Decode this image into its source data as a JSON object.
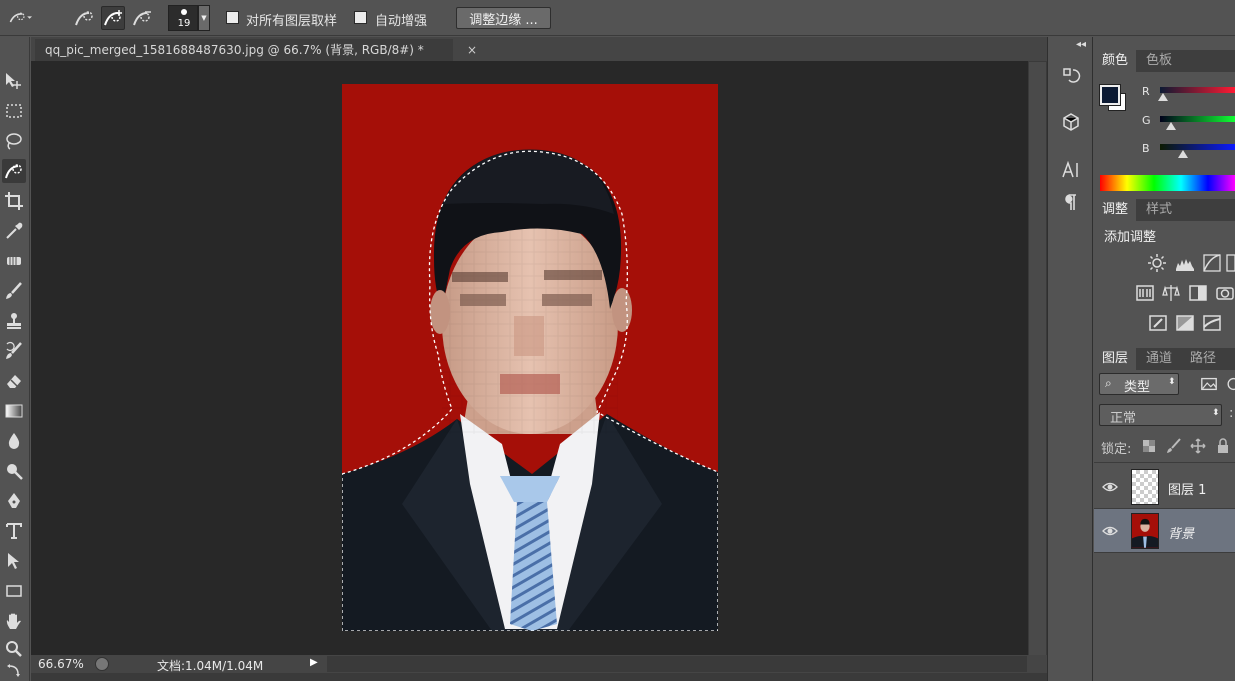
{
  "options_bar": {
    "brush_size": "19",
    "sample_all_layers_label": "对所有图层取样",
    "sample_all_layers_checked": false,
    "auto_enhance_label": "自动增强",
    "auto_enhance_checked": false,
    "refine_edge_label": "调整边缘 ..."
  },
  "document": {
    "tab_title": "qq_pic_merged_1581688487630.jpg @ 66.7% (背景, RGB/8#) *",
    "close_glyph": "×"
  },
  "status_bar": {
    "zoom": "66.67%",
    "doc_size": "文档:1.04M/1.04M"
  },
  "color_panel": {
    "tabs": [
      "颜色",
      "色板"
    ],
    "active_tab": 0,
    "foreground_color": "#0c1a33",
    "background_color": "#ffffff",
    "channels": [
      {
        "label": "R",
        "value": 12
      },
      {
        "label": "G",
        "value": 26
      },
      {
        "label": "B",
        "value": 51
      }
    ]
  },
  "adjustments_panel": {
    "tabs": [
      "调整",
      "样式"
    ],
    "active_tab": 0,
    "heading": "添加调整"
  },
  "layers_panel": {
    "tabs": [
      "图层",
      "通道",
      "路径"
    ],
    "active_tab": 0,
    "filter_kind": "类型",
    "blend_mode": "正常",
    "lock_label": "锁定:",
    "layers": [
      {
        "name": "图层 1",
        "visible": true,
        "selected": false,
        "kind": "transparent"
      },
      {
        "name": "背景",
        "visible": true,
        "selected": true,
        "kind": "photo"
      }
    ]
  },
  "colors": {
    "photo_background": "#a50f08",
    "suit": "#141a22",
    "tie": "#8fb3dc",
    "selection_outline": "#ffffff"
  }
}
